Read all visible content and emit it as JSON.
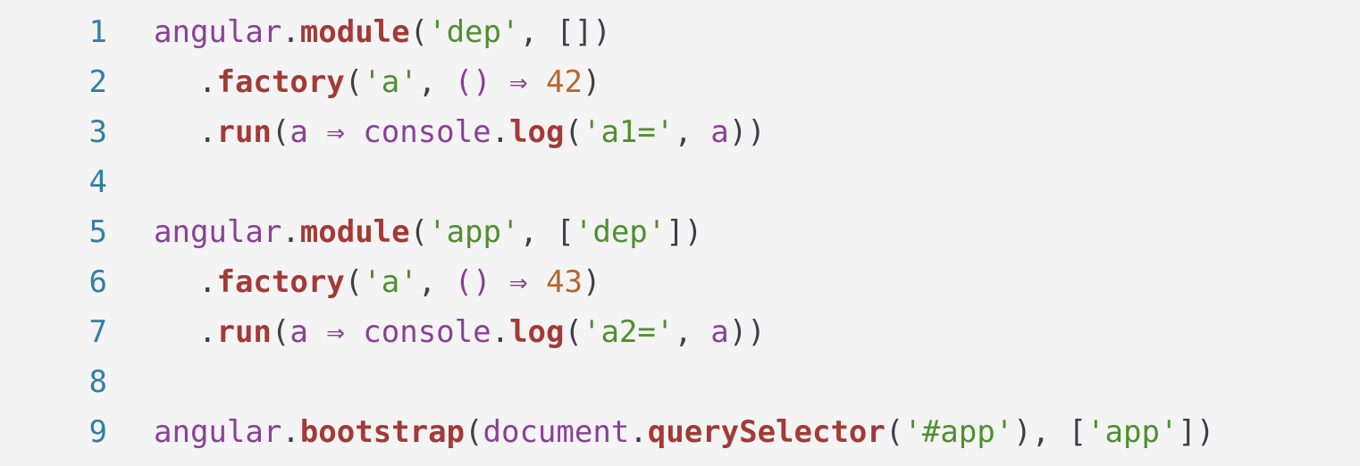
{
  "editor": {
    "lines": [
      {
        "number": "1",
        "indent": false,
        "tokens": [
          {
            "text": "angular",
            "type": "ident"
          },
          {
            "text": ".",
            "type": "plain"
          },
          {
            "text": "module",
            "type": "fn"
          },
          {
            "text": "(",
            "type": "plain"
          },
          {
            "text": "'dep'",
            "type": "str"
          },
          {
            "text": ", []",
            "type": "plain"
          },
          {
            "text": ")",
            "type": "plain"
          }
        ]
      },
      {
        "number": "2",
        "indent": true,
        "tokens": [
          {
            "text": ".",
            "type": "plain"
          },
          {
            "text": "factory",
            "type": "fn"
          },
          {
            "text": "(",
            "type": "plain"
          },
          {
            "text": "'a'",
            "type": "str"
          },
          {
            "text": ", ",
            "type": "plain"
          },
          {
            "text": "() ⇒ ",
            "type": "punct"
          },
          {
            "text": "42",
            "type": "num"
          },
          {
            "text": ")",
            "type": "plain"
          }
        ]
      },
      {
        "number": "3",
        "indent": true,
        "tokens": [
          {
            "text": ".",
            "type": "plain"
          },
          {
            "text": "run",
            "type": "fn"
          },
          {
            "text": "(",
            "type": "plain"
          },
          {
            "text": "a ⇒ ",
            "type": "punct"
          },
          {
            "text": "console",
            "type": "kw"
          },
          {
            "text": ".",
            "type": "plain"
          },
          {
            "text": "log",
            "type": "fn"
          },
          {
            "text": "(",
            "type": "plain"
          },
          {
            "text": "'a1='",
            "type": "str"
          },
          {
            "text": ", ",
            "type": "plain"
          },
          {
            "text": "a",
            "type": "punct"
          },
          {
            "text": "))",
            "type": "plain"
          }
        ]
      },
      {
        "number": "4",
        "indent": false,
        "tokens": []
      },
      {
        "number": "5",
        "indent": false,
        "tokens": [
          {
            "text": "angular",
            "type": "ident"
          },
          {
            "text": ".",
            "type": "plain"
          },
          {
            "text": "module",
            "type": "fn"
          },
          {
            "text": "(",
            "type": "plain"
          },
          {
            "text": "'app'",
            "type": "str"
          },
          {
            "text": ", [",
            "type": "plain"
          },
          {
            "text": "'dep'",
            "type": "str"
          },
          {
            "text": "])",
            "type": "plain"
          }
        ]
      },
      {
        "number": "6",
        "indent": true,
        "tokens": [
          {
            "text": ".",
            "type": "plain"
          },
          {
            "text": "factory",
            "type": "fn"
          },
          {
            "text": "(",
            "type": "plain"
          },
          {
            "text": "'a'",
            "type": "str"
          },
          {
            "text": ", ",
            "type": "plain"
          },
          {
            "text": "() ⇒ ",
            "type": "punct"
          },
          {
            "text": "43",
            "type": "num"
          },
          {
            "text": ")",
            "type": "plain"
          }
        ]
      },
      {
        "number": "7",
        "indent": true,
        "tokens": [
          {
            "text": ".",
            "type": "plain"
          },
          {
            "text": "run",
            "type": "fn"
          },
          {
            "text": "(",
            "type": "plain"
          },
          {
            "text": "a ⇒ ",
            "type": "punct"
          },
          {
            "text": "console",
            "type": "kw"
          },
          {
            "text": ".",
            "type": "plain"
          },
          {
            "text": "log",
            "type": "fn"
          },
          {
            "text": "(",
            "type": "plain"
          },
          {
            "text": "'a2='",
            "type": "str"
          },
          {
            "text": ", ",
            "type": "plain"
          },
          {
            "text": "a",
            "type": "punct"
          },
          {
            "text": "))",
            "type": "plain"
          }
        ]
      },
      {
        "number": "8",
        "indent": false,
        "tokens": []
      },
      {
        "number": "9",
        "indent": false,
        "tokens": [
          {
            "text": "angular",
            "type": "ident"
          },
          {
            "text": ".",
            "type": "plain"
          },
          {
            "text": "bootstrap",
            "type": "fn"
          },
          {
            "text": "(",
            "type": "plain"
          },
          {
            "text": "document",
            "type": "ident"
          },
          {
            "text": ".",
            "type": "plain"
          },
          {
            "text": "querySelector",
            "type": "fn"
          },
          {
            "text": "(",
            "type": "plain"
          },
          {
            "text": "'#app'",
            "type": "str"
          },
          {
            "text": "), [",
            "type": "plain"
          },
          {
            "text": "'app'",
            "type": "str"
          },
          {
            "text": "])",
            "type": "plain"
          }
        ]
      }
    ]
  }
}
